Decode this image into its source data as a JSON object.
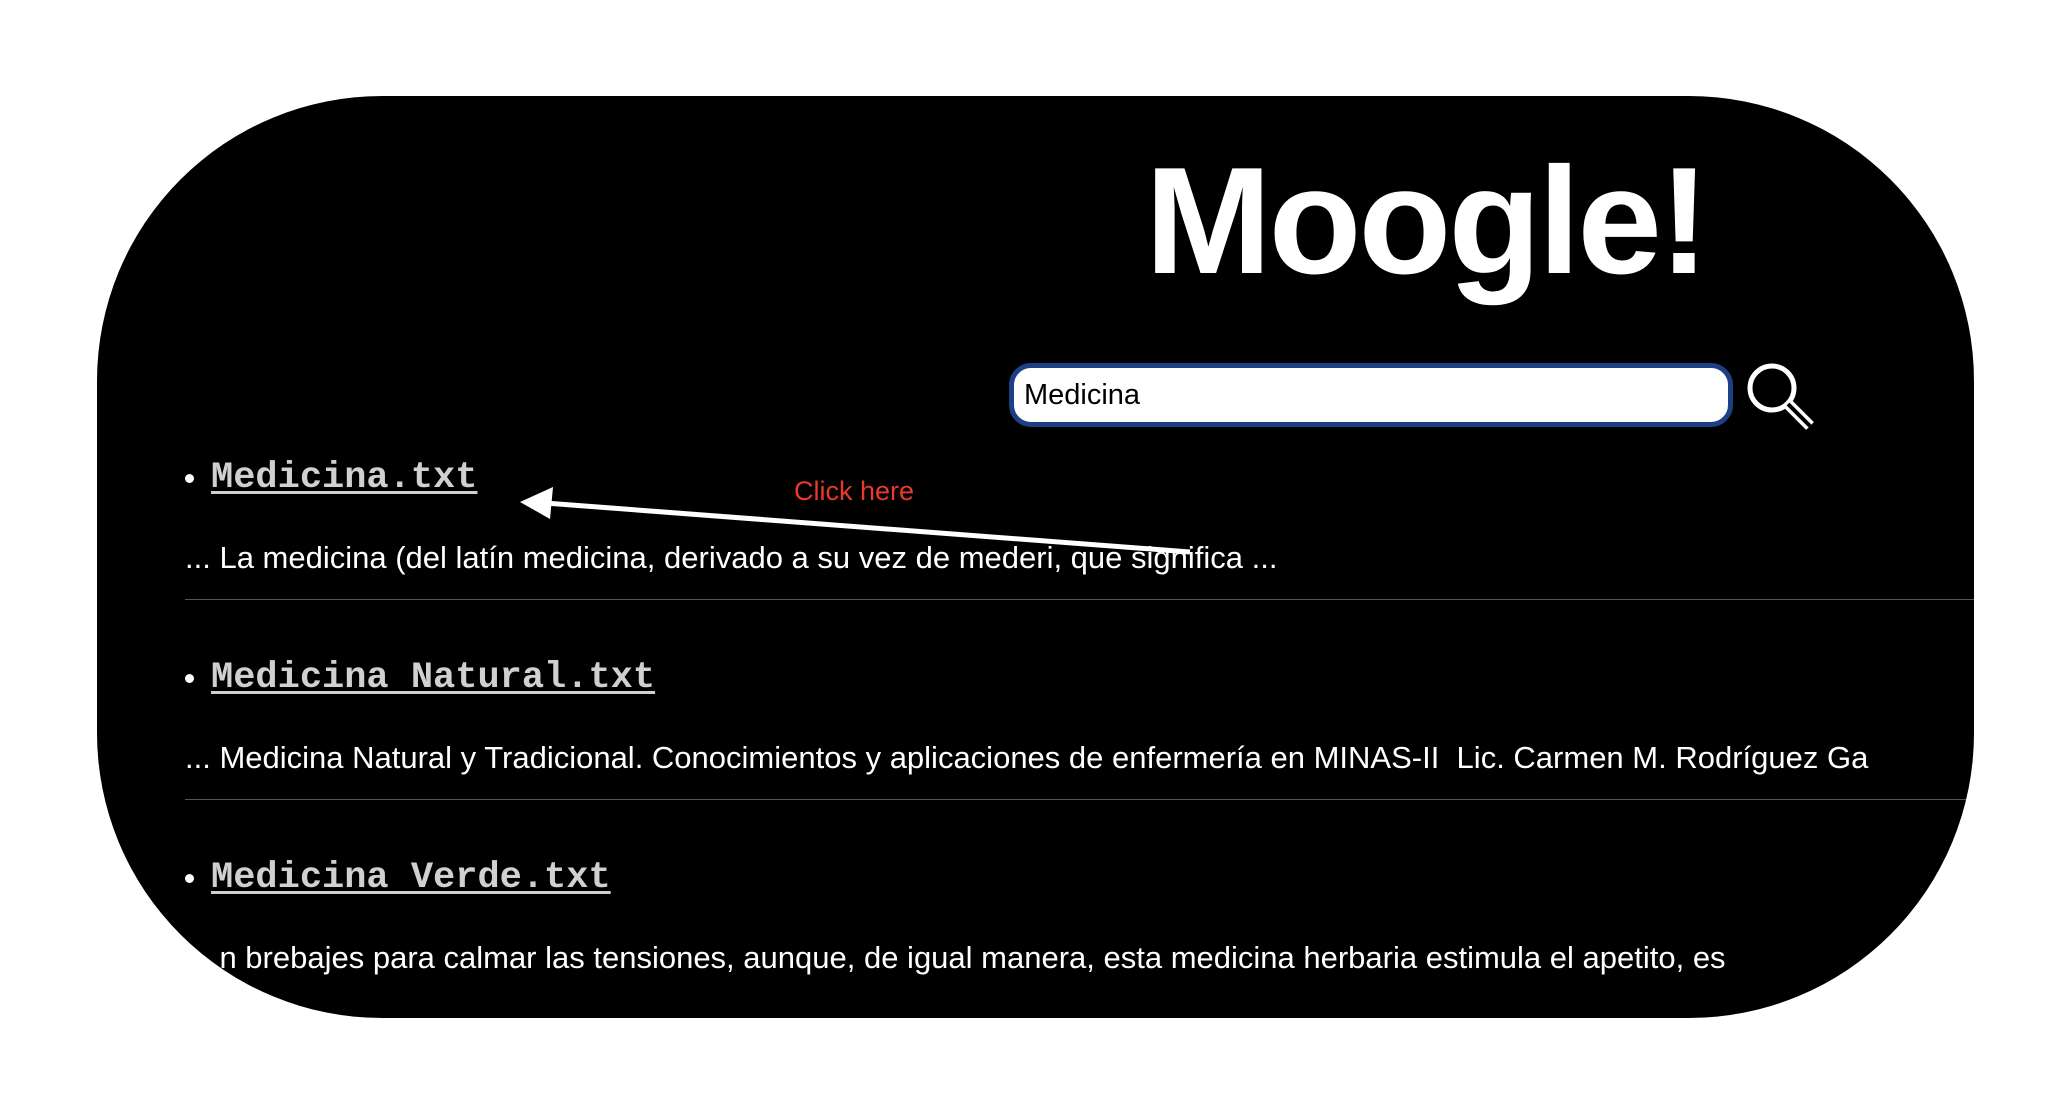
{
  "app": {
    "title": "Moogle!"
  },
  "search": {
    "value": "Medicina",
    "button_icon": "magnifier-icon"
  },
  "results": [
    {
      "title": "Medicina.txt",
      "snippet": "... La medicina (del latín medicina, derivado a su vez de mederi, que significa ..."
    },
    {
      "title": "Medicina Natural.txt",
      "snippet": "... Medicina Natural y Tradicional. Conocimientos y aplicaciones de enfermería en MINAS-II  Lic. Carmen M. Rodríguez Ga"
    },
    {
      "title": "Medicina Verde.txt",
      "snippet": "... n brebajes para calmar las tensiones, aunque, de igual manera, esta medicina herbaria estimula el apetito, es"
    }
  ],
  "annotation": {
    "text": "Click here",
    "color": "#e8392b"
  },
  "colors": {
    "background": "#000000",
    "link": "#d0d0d0",
    "search_border": "#1c3f86"
  }
}
